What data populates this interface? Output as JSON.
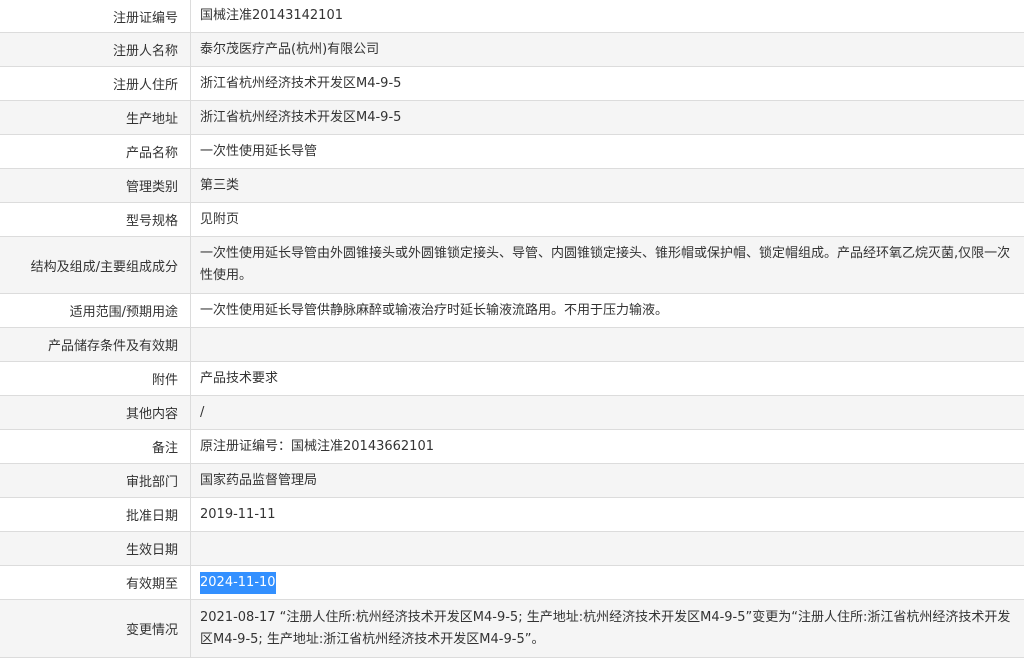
{
  "rows": [
    {
      "label": "注册证编号",
      "value": "国械注准20143142101"
    },
    {
      "label": "注册人名称",
      "value": "泰尔茂医疗产品(杭州)有限公司"
    },
    {
      "label": "注册人住所",
      "value": "浙江省杭州经济技术开发区M4-9-5"
    },
    {
      "label": "生产地址",
      "value": "浙江省杭州经济技术开发区M4-9-5"
    },
    {
      "label": "产品名称",
      "value": "一次性使用延长导管"
    },
    {
      "label": "管理类别",
      "value": "第三类"
    },
    {
      "label": "型号规格",
      "value": "见附页"
    },
    {
      "label": "结构及组成/主要组成成分",
      "value": "一次性使用延长导管由外圆锥接头或外圆锥锁定接头、导管、内圆锥锁定接头、锥形帽或保护帽、锁定帽组成。产品经环氧乙烷灭菌,仅限一次性使用。"
    },
    {
      "label": "适用范围/预期用途",
      "value": "一次性使用延长导管供静脉麻醉或输液治疗时延长输液流路用。不用于压力输液。"
    },
    {
      "label": "产品储存条件及有效期",
      "value": ""
    },
    {
      "label": "附件",
      "value": "产品技术要求"
    },
    {
      "label": "其他内容",
      "value": "/"
    },
    {
      "label": "备注",
      "value": "原注册证编号：国械注准20143662101"
    },
    {
      "label": "审批部门",
      "value": "国家药品监督管理局"
    },
    {
      "label": "批准日期",
      "value": "2019-11-11"
    },
    {
      "label": "生效日期",
      "value": ""
    },
    {
      "label": "有效期至",
      "value": "2024-11-10"
    },
    {
      "label": "变更情况",
      "value": "2021-08-17 “注册人住所:杭州经济技术开发区M4-9-5; 生产地址:杭州经济技术开发区M4-9-5”变更为“注册人住所:浙江省杭州经济技术开发区M4-9-5; 生产地址:浙江省杭州经济技术开发区M4-9-5”。"
    }
  ],
  "selection": {
    "row_label": "有效期至",
    "text": "2024-11-10"
  }
}
